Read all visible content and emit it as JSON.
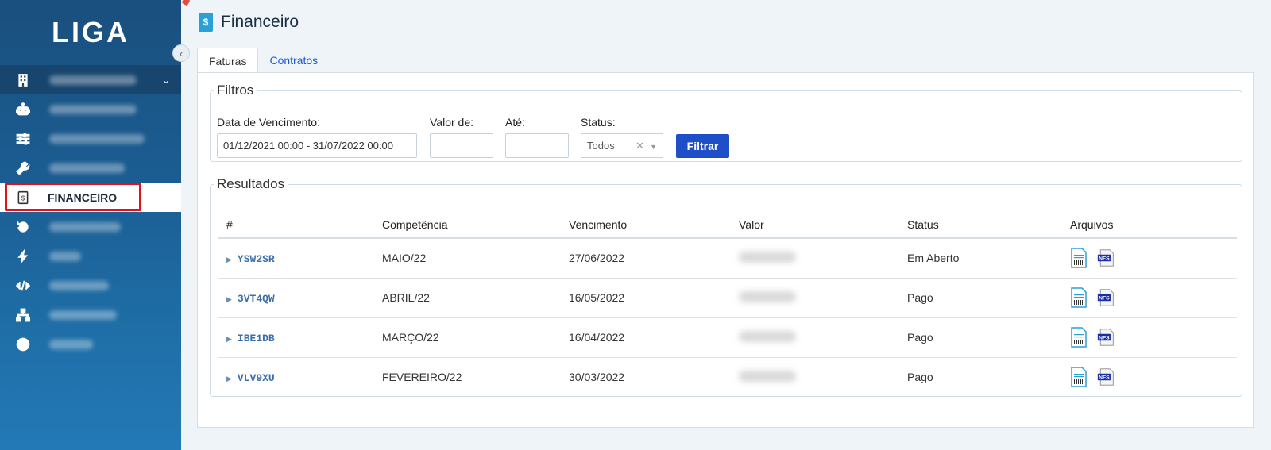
{
  "app": {
    "logo_text": "LIGA"
  },
  "sidebar": {
    "items": [
      {
        "name": "company",
        "icon": "building-icon",
        "label": ""
      },
      {
        "name": "bot",
        "icon": "robot-icon",
        "label": ""
      },
      {
        "name": "settings",
        "icon": "sliders-icon",
        "label": ""
      },
      {
        "name": "tools",
        "icon": "wrench-icon",
        "label": ""
      },
      {
        "name": "financeiro",
        "icon": "invoice-icon",
        "label": "FINANCEIRO"
      },
      {
        "name": "history",
        "icon": "history-icon",
        "label": ""
      },
      {
        "name": "actions",
        "icon": "bolt-icon",
        "label": ""
      },
      {
        "name": "code",
        "icon": "code-icon",
        "label": ""
      },
      {
        "name": "network",
        "icon": "sitemap-icon",
        "label": ""
      },
      {
        "name": "help",
        "icon": "question-icon",
        "label": ""
      }
    ]
  },
  "page": {
    "title": "Financeiro"
  },
  "tabs": [
    {
      "label": "Faturas",
      "active": true
    },
    {
      "label": "Contratos",
      "active": false
    }
  ],
  "filters": {
    "legend": "Filtros",
    "due_date": {
      "label": "Data de Vencimento:",
      "value": "01/12/2021 00:00 - 31/07/2022 00:00"
    },
    "valor_de": {
      "label": "Valor de:",
      "value": ""
    },
    "ate": {
      "label": "Até:",
      "value": ""
    },
    "status": {
      "label": "Status:",
      "value": "Todos"
    },
    "button": "Filtrar"
  },
  "results": {
    "legend": "Resultados",
    "columns": [
      "#",
      "Competência",
      "Vencimento",
      "Valor",
      "Status",
      "Arquivos"
    ],
    "rows": [
      {
        "id": "YSW2SR",
        "competencia": "MAIO/22",
        "vencimento": "27/06/2022",
        "status": "Em Aberto"
      },
      {
        "id": "3VT4QW",
        "competencia": "ABRIL/22",
        "vencimento": "16/05/2022",
        "status": "Pago"
      },
      {
        "id": "IBE1DB",
        "competencia": "MARÇO/22",
        "vencimento": "16/04/2022",
        "status": "Pago"
      },
      {
        "id": "VLV9XU",
        "competencia": "FEVEREIRO/22",
        "vencimento": "30/03/2022",
        "status": "Pago"
      }
    ],
    "file_icons": [
      "boleto-icon",
      "nfs-icon"
    ],
    "nfs_label": "NFS"
  },
  "colors": {
    "sidebar": "#1b5d92",
    "accent": "#1f4ec9",
    "highlight": "#e0131b"
  }
}
